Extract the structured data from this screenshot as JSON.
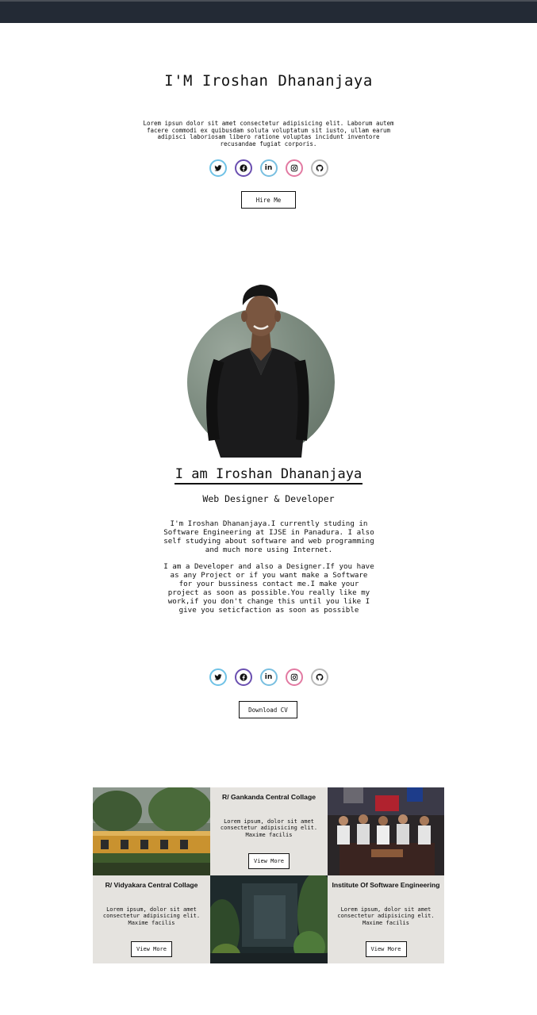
{
  "hero": {
    "title": "I'M Iroshan Dhananjaya",
    "text": "Lorem ipsun dolor sit amet consectetur adipisicing elit. Laborum autem facere commodi ex quibusdam soluta voluptatum sit iusto, ullam earum adipisci laboriosam libero ratione voluptas incidunt inventore recusandae fugiat corporis.",
    "hire_label": "Hire Me"
  },
  "socials": [
    {
      "icon": "twitter-icon",
      "glyph": "twitter",
      "color": "#6fc2e6"
    },
    {
      "icon": "facebook-icon",
      "glyph": "facebook",
      "color": "#6a4fb0"
    },
    {
      "icon": "linkedin-icon",
      "glyph": "in",
      "color": "#78bfe0"
    },
    {
      "icon": "instagram-icon",
      "glyph": "instagram",
      "color": "#e27aa2"
    },
    {
      "icon": "github-icon",
      "glyph": "github",
      "color": "#b8b8b8"
    }
  ],
  "about": {
    "name": "I am Iroshan Dhananjaya",
    "role": "Web Designer & Developer",
    "p1": "I'm Iroshan Dhananjaya.I currently studing in Software Engineering at IJSE in Panadura. I also self studying about software and web programming and much more using Internet.",
    "p2": "I am a Developer and also a Designer.If you have as any Project or if you want make a Software for your bussiness contact me.I make your project as soon as possible.You really like my work,if you don't change this until you like I give you seticfaction as soon as possible",
    "cv_label": "Download CV"
  },
  "education": [
    {
      "title": "R/ Gankanda Central Collage",
      "text": "Lorem ipsum, dolor sit amet consectetur adipisicing elit. Maxime facilis",
      "button": "View More"
    },
    {
      "title": "R/ Vidyakara Central Collage",
      "text": "Lorem ipsum, dolor sit amet consectetur adipisicing elit. Maxime facilis",
      "button": "View More"
    },
    {
      "title": "Institute Of Software Engineering",
      "text": "Lorem ipsum, dolor sit amet consectetur adipisicing elit. Maxime facilis",
      "button": "View More"
    }
  ],
  "colors": {
    "topbar": "#232a35",
    "card_bg": "#e5e3df"
  }
}
